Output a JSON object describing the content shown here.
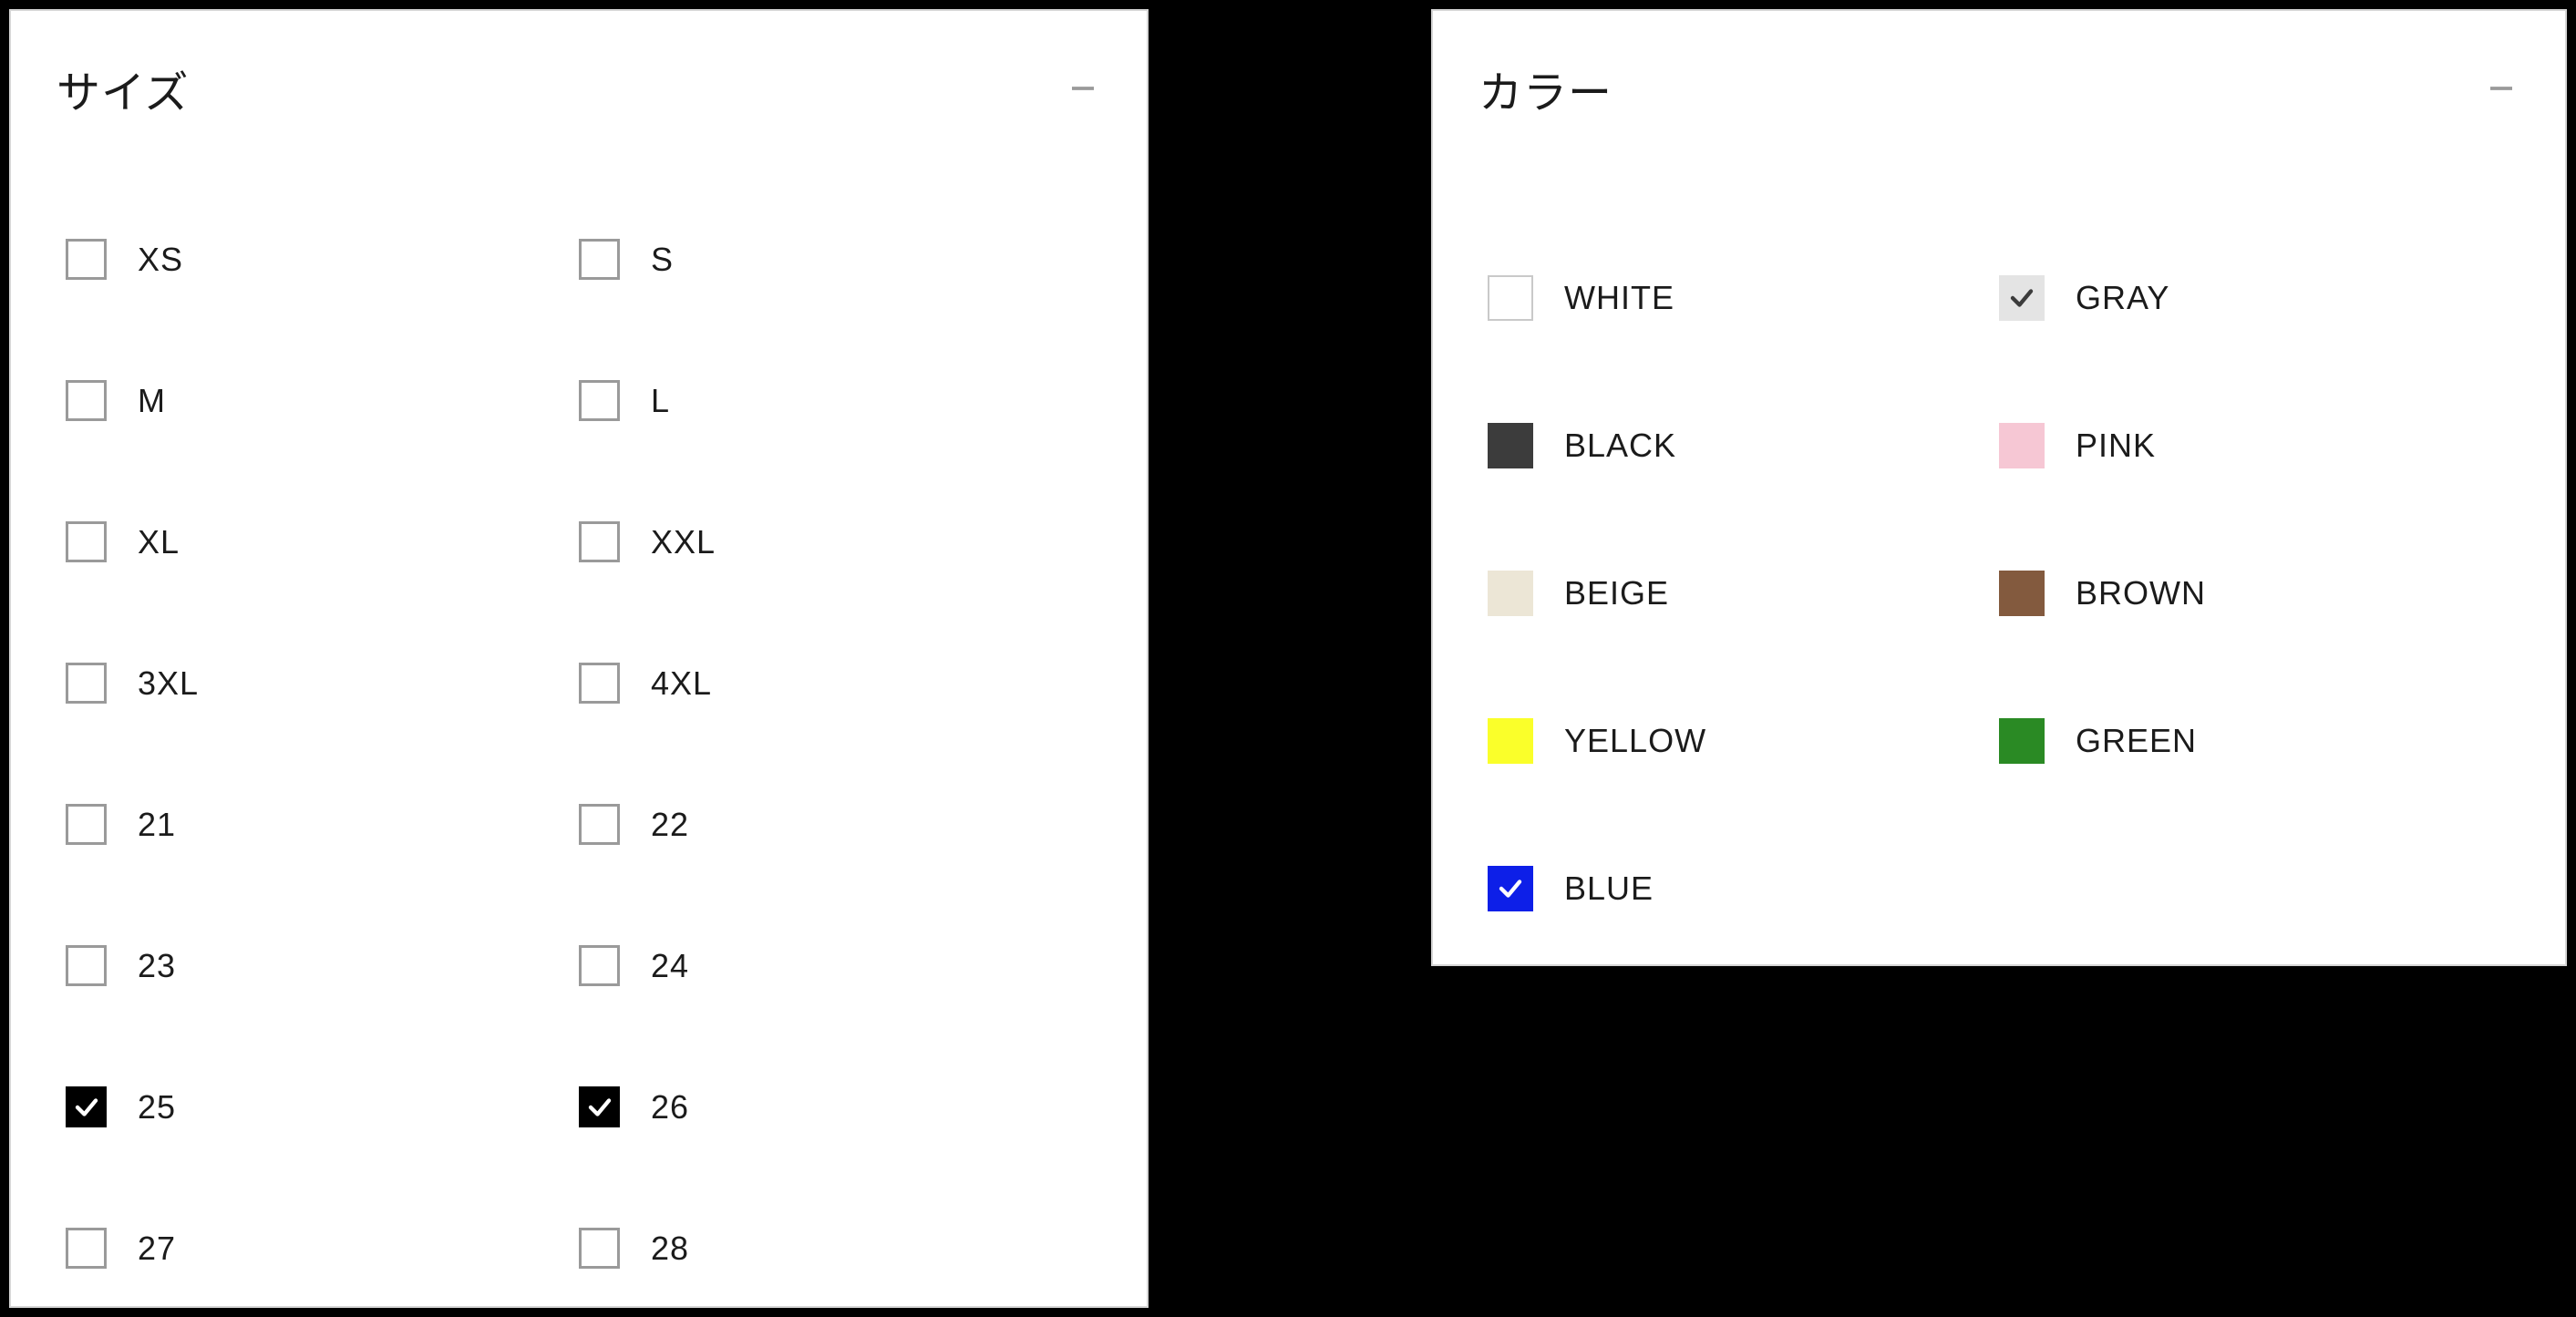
{
  "sizePanel": {
    "title": "サイズ",
    "options": [
      {
        "label": "XS",
        "checked": false
      },
      {
        "label": "S",
        "checked": false
      },
      {
        "label": "M",
        "checked": false
      },
      {
        "label": "L",
        "checked": false
      },
      {
        "label": "XL",
        "checked": false
      },
      {
        "label": "XXL",
        "checked": false
      },
      {
        "label": "3XL",
        "checked": false
      },
      {
        "label": "4XL",
        "checked": false
      },
      {
        "label": "21",
        "checked": false
      },
      {
        "label": "22",
        "checked": false
      },
      {
        "label": "23",
        "checked": false
      },
      {
        "label": "24",
        "checked": false
      },
      {
        "label": "25",
        "checked": true
      },
      {
        "label": "26",
        "checked": true
      },
      {
        "label": "27",
        "checked": false
      },
      {
        "label": "28",
        "checked": false
      }
    ]
  },
  "colorPanel": {
    "title": "カラー",
    "options": [
      {
        "label": "WHITE",
        "hex": "#ffffff",
        "border": "#c9c9c9",
        "checked": false,
        "checkStyle": ""
      },
      {
        "label": "GRAY",
        "hex": "#e4e4e4",
        "border": "#e4e4e4",
        "checked": true,
        "checkStyle": "checked-light"
      },
      {
        "label": "BLACK",
        "hex": "#3c3c3c",
        "border": "#3c3c3c",
        "checked": false,
        "checkStyle": ""
      },
      {
        "label": "PINK",
        "hex": "#f6c7d4",
        "border": "#f6c7d4",
        "checked": false,
        "checkStyle": ""
      },
      {
        "label": "BEIGE",
        "hex": "#ece6d6",
        "border": "#ece6d6",
        "checked": false,
        "checkStyle": ""
      },
      {
        "label": "BROWN",
        "hex": "#835a3e",
        "border": "#835a3e",
        "checked": false,
        "checkStyle": ""
      },
      {
        "label": "YELLOW",
        "hex": "#faff2a",
        "border": "#faff2a",
        "checked": false,
        "checkStyle": ""
      },
      {
        "label": "GREEN",
        "hex": "#2a8a24",
        "border": "#2a8a24",
        "checked": false,
        "checkStyle": ""
      },
      {
        "label": "BLUE",
        "hex": "#0d1fe8",
        "border": "#0d1fe8",
        "checked": true,
        "checkStyle": "checked-dark"
      }
    ]
  }
}
